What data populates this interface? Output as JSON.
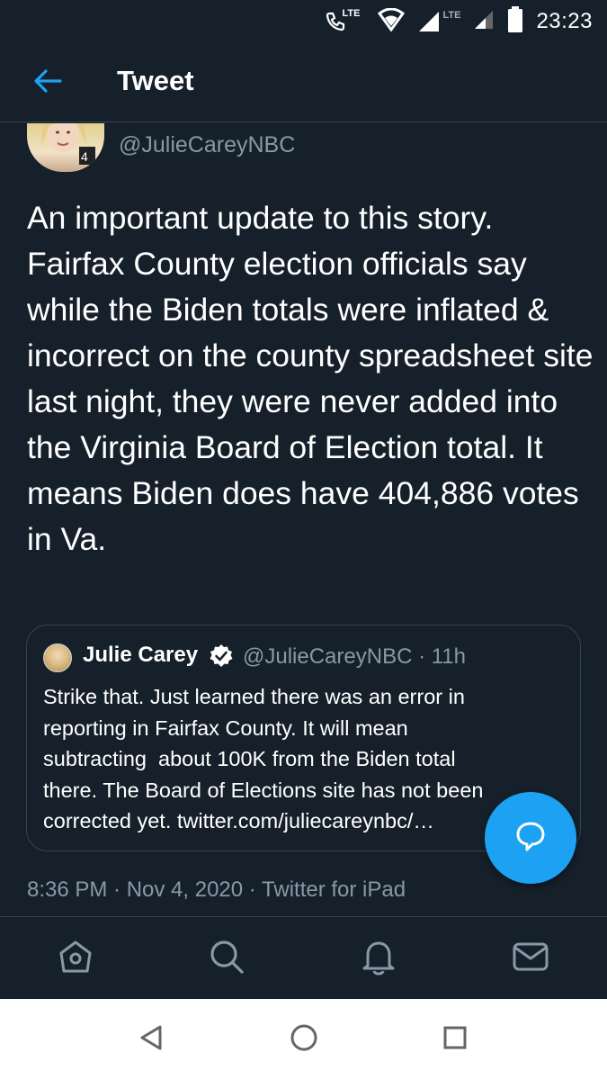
{
  "status_bar": {
    "network_left": "LTE",
    "network_right": "LTE",
    "time": "23:23"
  },
  "header": {
    "back_icon": "arrow-left-icon",
    "title": "Tweet"
  },
  "tweet": {
    "handle": "@JulieCareyNBC",
    "text": "An important update to this story. Fairfax County election officials say while the Biden totals were inflated & incorrect on the county spreadsheet site last night, they were never added into the Virginia Board of Election total. It means Biden does have 404,886 votes in Va.",
    "meta": "8:36 PM · Nov 4, 2020 · Twitter for iPad"
  },
  "quoted_tweet": {
    "name": "Julie Carey",
    "handle_time": "@JulieCareyNBC · 11h",
    "text": "Strike that. Just learned there was an error in\nreporting in Fairfax County. It will mean\nsubtracting  about 100K from the Biden total\nthere. The Board of Elections site has not been\ncorrected yet. twitter.com/juliecareynbc/…"
  },
  "tabs": [
    "home-icon",
    "search-icon",
    "notifications-icon",
    "messages-icon"
  ],
  "nav": [
    "back-triangle-icon",
    "home-circle-icon",
    "recents-square-icon"
  ],
  "colors": {
    "background": "#15202b",
    "accent": "#1da1f2",
    "secondary_text": "#8899a6",
    "border": "#38444d"
  }
}
